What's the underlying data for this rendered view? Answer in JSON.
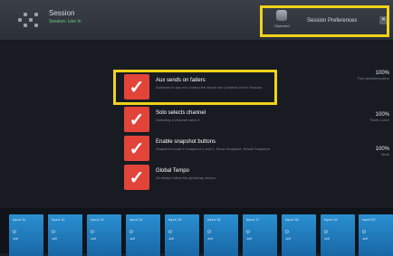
{
  "header": {
    "session_title": "Session",
    "session_subtitle": "Session: Line In",
    "clipboard_label": "Clipboard",
    "preferences_label": "Session Preferences",
    "close_glyph": "✕"
  },
  "settings": [
    {
      "label": "Aux sends on faders",
      "description": "Switches to aux mix control the whole row of faders in the Session."
    },
    {
      "label": "Solo selects channel",
      "description": "Selecting a channel solos it."
    },
    {
      "label": "Enable snapshot buttons",
      "description": "Snapshot recall in Snapshot 1 and 2, Show Snapshot, Recall Snapshot"
    },
    {
      "label": "Global Tempo",
      "description": "All delays follow the global tap tempo"
    }
  ],
  "check_glyph": "✓",
  "side_values": [
    {
      "value": "100%",
      "desc": "Pan law/attenuation"
    },
    {
      "value": "100%",
      "desc": "Fader curve"
    },
    {
      "value": "100%",
      "desc": "Mute"
    }
  ],
  "inputs": [
    {
      "name": "Input 11",
      "value": "-inf"
    },
    {
      "name": "Input 12",
      "value": "-inf"
    },
    {
      "name": "Input 13",
      "value": "-inf"
    },
    {
      "name": "Input 14",
      "value": "-inf"
    },
    {
      "name": "Input 15",
      "value": "-inf"
    },
    {
      "name": "Input 16",
      "value": "-inf"
    },
    {
      "name": "Input 17",
      "value": "-inf"
    },
    {
      "name": "Input 18",
      "value": "-inf"
    },
    {
      "name": "Input 19",
      "value": "-inf"
    },
    {
      "name": "Input 20",
      "value": "-inf"
    }
  ],
  "input_icon": "⏻",
  "colors": {
    "highlight": "#f2d21a",
    "checkbox": "#e2443a",
    "input_tile": "#1f7dbf"
  }
}
